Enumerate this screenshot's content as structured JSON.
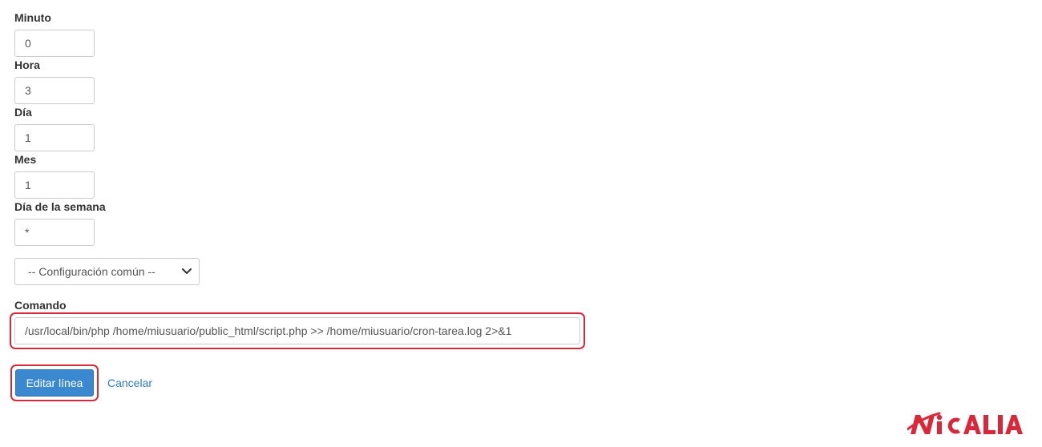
{
  "form": {
    "minute": {
      "label": "Minuto",
      "value": "0"
    },
    "hour": {
      "label": "Hora",
      "value": "3"
    },
    "day": {
      "label": "Día",
      "value": "1"
    },
    "month": {
      "label": "Mes",
      "value": "1"
    },
    "weekday": {
      "label": "Día de la semana",
      "value": "*"
    },
    "common_settings": {
      "selected": "-- Configuración común --"
    },
    "command": {
      "label": "Comando",
      "value": "/usr/local/bin/php /home/miusuario/public_html/script.php >> /home/miusuario/cron-tarea.log 2>&1"
    }
  },
  "actions": {
    "edit_label": "Editar línea",
    "cancel_label": "Cancelar"
  },
  "logo": {
    "text": "NICALIA",
    "color": "#d9283a"
  },
  "colors": {
    "highlight": "#d9283a",
    "primary_button": "#3a88d0",
    "link": "#2e7ac4"
  }
}
